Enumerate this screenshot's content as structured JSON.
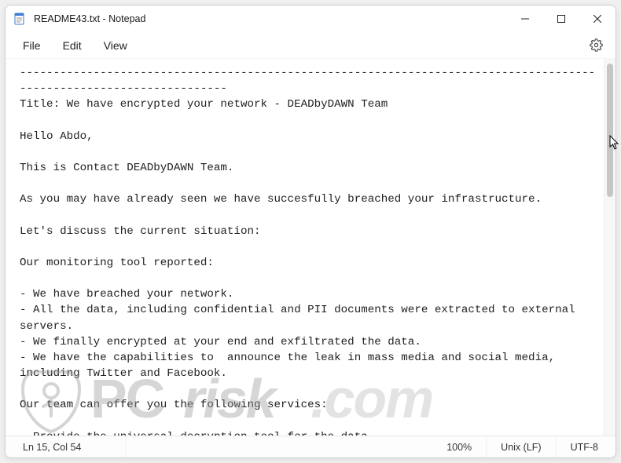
{
  "window": {
    "title": "README43.txt - Notepad"
  },
  "menu": {
    "file": "File",
    "edit": "Edit",
    "view": "View"
  },
  "document": {
    "text": "---------------------------------------------------------------------------------------------------------------------\nTitle: We have encrypted your network - DEADbyDAWN Team\n\nHello Abdo,\n\nThis is Contact DEADbyDAWN Team.\n\nAs you may have already seen we have succesfully breached your infrastructure.\n\nLet's discuss the current situation:\n\nOur monitoring tool reported:\n\n- We have breached your network.\n- All the data, including confidential and PII documents were extracted to external servers.\n- We finally encrypted at your end and exfiltrated the data.\n- We have the capabilities to  announce the leak in mass media and social media, including Twitter and Facebook.\n\nOur team can offer you the following services:\n\n- Provide the universal decryption tool for the data\n- Assist with infrastructure restore"
  },
  "status": {
    "cursor_pos": "Ln 15, Col 54",
    "zoom": "100%",
    "line_ending": "Unix (LF)",
    "encoding": "UTF-8"
  },
  "watermark": {
    "text": "PCrisk.com"
  }
}
